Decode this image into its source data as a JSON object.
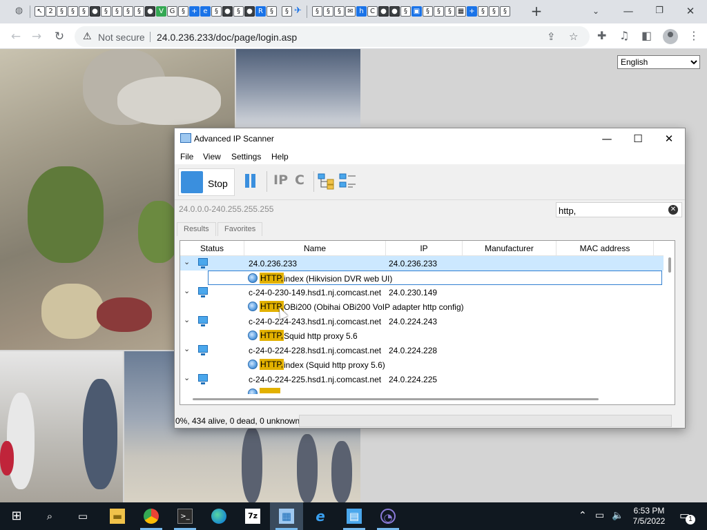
{
  "browser": {
    "tab_icons": [
      "globe-icon",
      "bookmark-icon",
      "bookmark-icon",
      "bookmark-icon",
      "bookmark-icon",
      "bookmark-icon",
      "bookmark-icon",
      "bookmark-icon",
      "bookmark-icon",
      "bookmark-icon",
      "bookmark-icon",
      "bookmark-icon",
      "bookmark-icon",
      "bookmark-icon",
      "bookmark-icon"
    ],
    "new_tab_label": "+",
    "nav": {
      "back": "←",
      "forward": "→",
      "reload": "↻"
    },
    "address": {
      "security_label": "Not secure",
      "url": "24.0.236.233/doc/page/login.asp"
    }
  },
  "webpage": {
    "language_select": {
      "selected": "English",
      "options": [
        "English"
      ]
    }
  },
  "ip_scanner": {
    "title": "Advanced IP Scanner",
    "window_controls": {
      "minimize": "—",
      "maximize": "☐",
      "close": "✕"
    },
    "menu": [
      "File",
      "View",
      "Settings",
      "Help"
    ],
    "toolbar": {
      "stop_label": "Stop",
      "ip_label": "IP",
      "c_label": "C"
    },
    "range": "24.0.0.0-240.255.255.255",
    "filter": "http,",
    "tabs": [
      "Results",
      "Favorites"
    ],
    "columns": [
      "Status",
      "Name",
      "IP",
      "Manufacturer",
      "MAC address"
    ],
    "hosts": [
      {
        "name": "24.0.236.233",
        "ip": "24.0.236.233",
        "service_tag": "HTTP,",
        "service": "index (Hikvision DVR web UI)"
      },
      {
        "name": "c-24-0-230-149.hsd1.nj.comcast.net",
        "ip": "24.0.230.149",
        "service_tag": "HTTP,",
        "service": "OBi200 (Obihai OBi200 VoIP adapter http config)"
      },
      {
        "name": "c-24-0-224-243.hsd1.nj.comcast.net",
        "ip": "24.0.224.243",
        "service_tag": "HTTP,",
        "service": "Squid http proxy 5.6"
      },
      {
        "name": "c-24-0-224-228.hsd1.nj.comcast.net",
        "ip": "24.0.224.228",
        "service_tag": "HTTP,",
        "service": "index (Squid http proxy 5.6)"
      },
      {
        "name": "c-24-0-224-225.hsd1.nj.comcast.net",
        "ip": "24.0.224.225",
        "service_tag": "",
        "service": ""
      }
    ],
    "status": "0%, 434 alive, 0 dead, 0 unknown",
    "progress": 0
  },
  "taskbar": {
    "apps": [
      "start-icon",
      "search-icon",
      "task-view-icon",
      "file-explorer-icon",
      "chrome-icon",
      "terminal-icon",
      "edge-icon",
      "7zip-icon",
      "ip-scanner-icon",
      "ie-icon",
      "network-app-icon",
      "obs-icon"
    ],
    "time": "6:53 PM",
    "date": "7/5/2022",
    "notification_count": "1"
  }
}
